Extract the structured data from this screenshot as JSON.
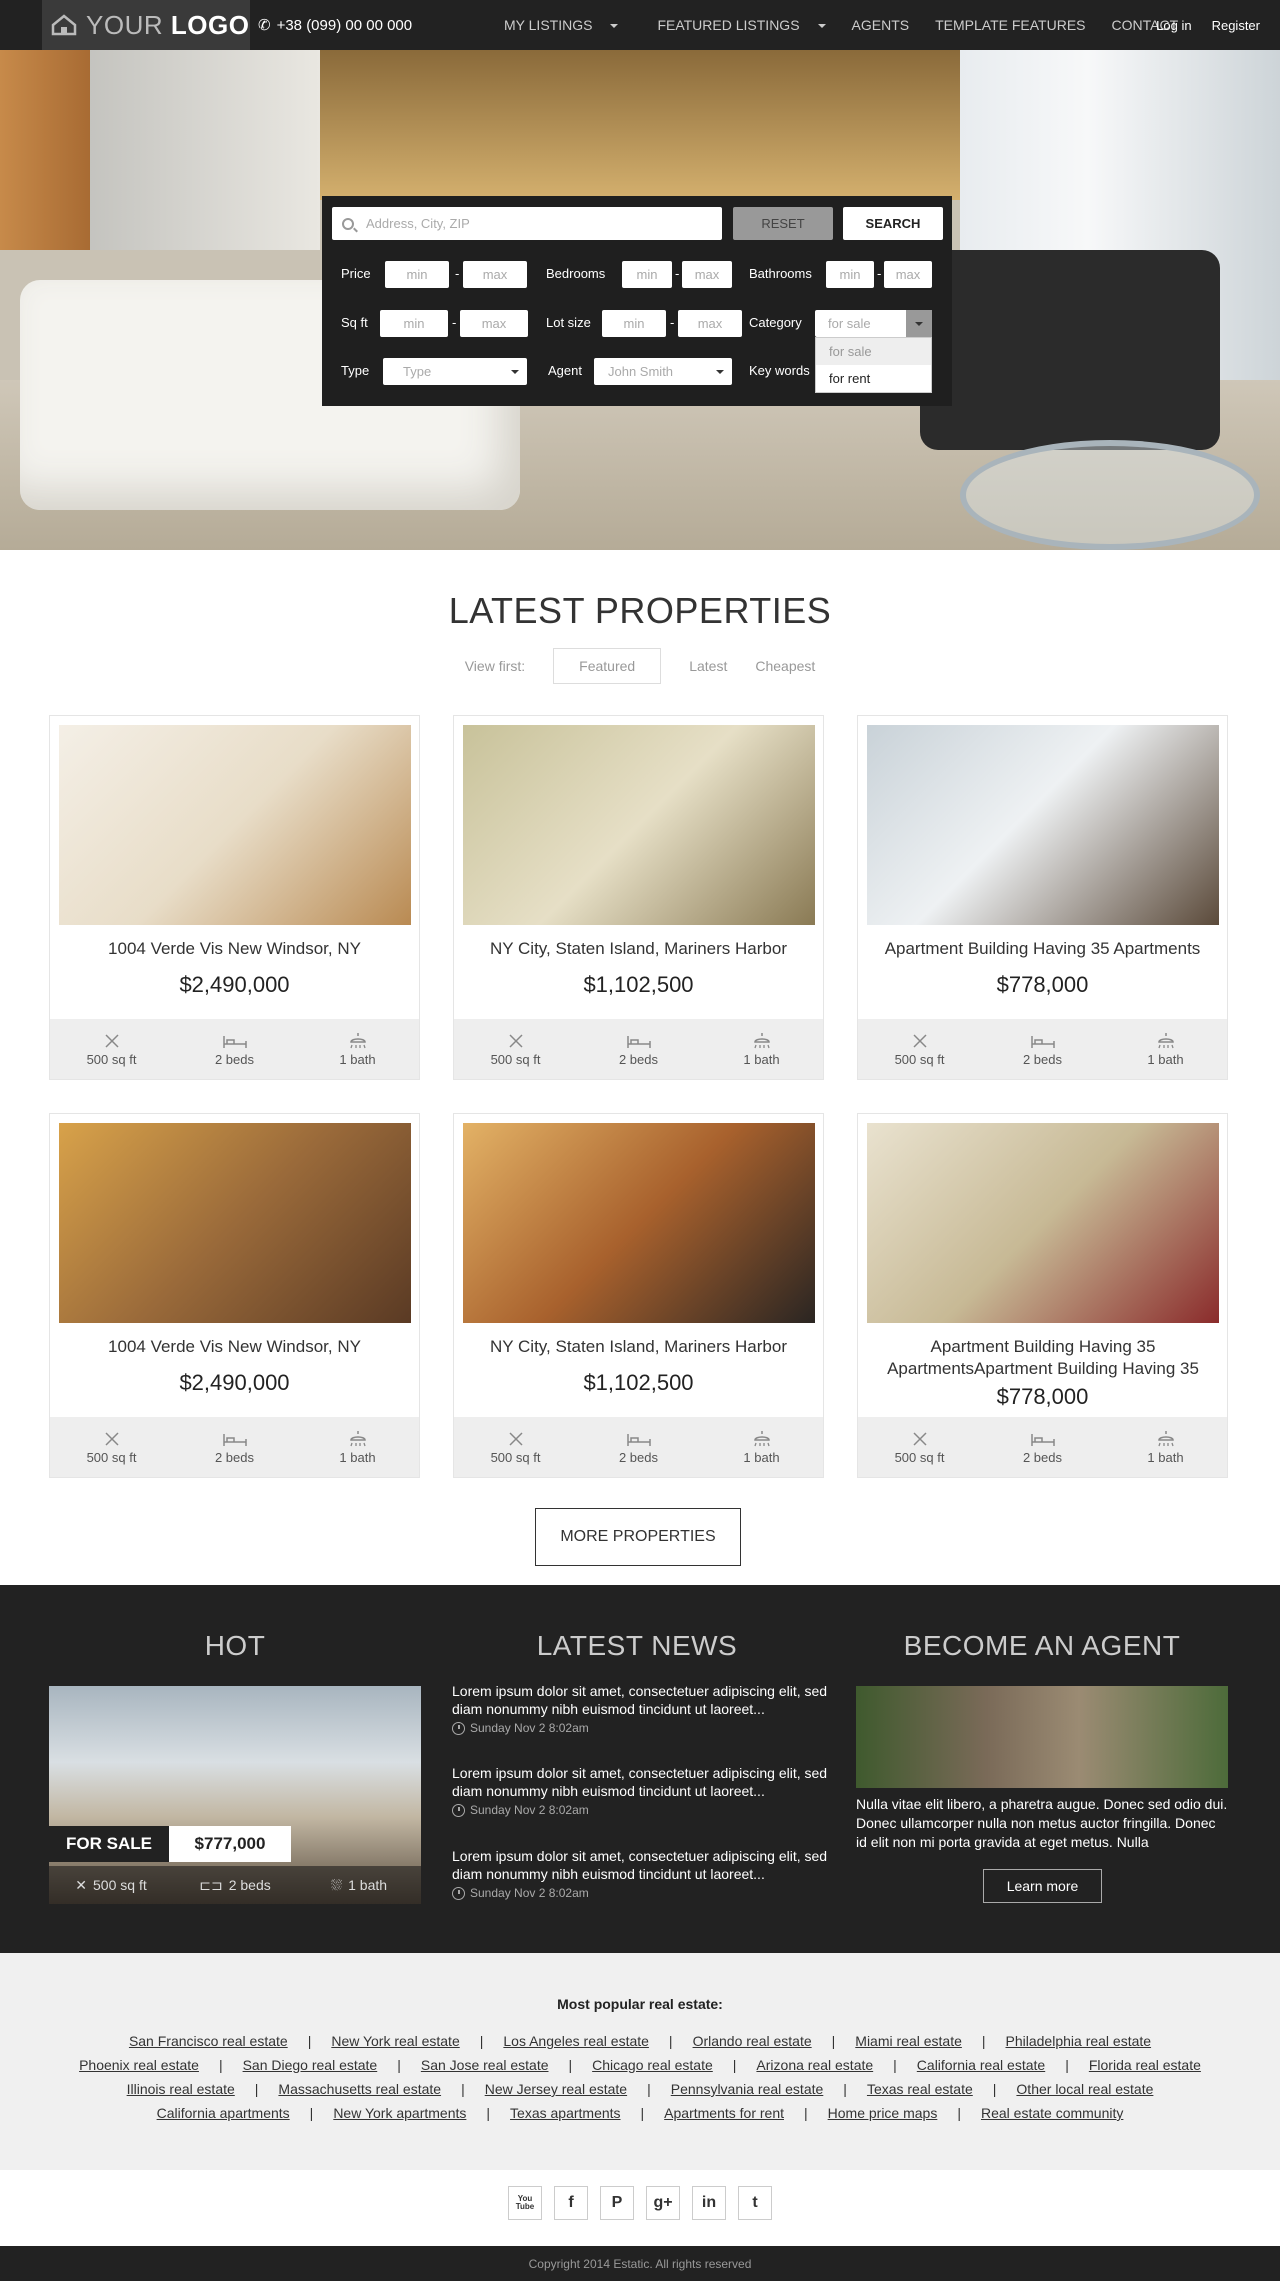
{
  "nav": {
    "logo_light": "YOUR",
    "logo_bold": "LOGO",
    "phone": "+38 (099) 00 00 000",
    "links": [
      "MY LISTINGS",
      "FEATURED LISTINGS",
      "AGENTS",
      "TEMPLATE FEATURES",
      "CONTACT"
    ],
    "login": "Log in",
    "register": "Register"
  },
  "search": {
    "address_placeholder": "Address, City, ZIP",
    "reset": "RESET",
    "search": "SEARCH",
    "labels": {
      "price": "Price",
      "bedrooms": "Bedrooms",
      "bathrooms": "Bathrooms",
      "sqft": "Sq ft",
      "lot": "Lot size",
      "category": "Category",
      "type": "Type",
      "agent": "Agent",
      "keywords": "Key words"
    },
    "min": "min",
    "max": "max",
    "dash": "-",
    "type_value": "Type",
    "agent_value": "John Smith",
    "category_value": "for sale",
    "category_options": [
      "for sale",
      "for rent"
    ]
  },
  "latest": {
    "title": "LATEST PROPERTIES",
    "view_first": "View first:",
    "tabs": [
      "Featured",
      "Latest",
      "Cheapest"
    ],
    "more": "MORE PROPERTIES"
  },
  "properties": [
    {
      "title": "1004 Verde Vis New Windsor, NY",
      "price": "$2,490,000",
      "sqft": "500 sq ft",
      "beds": "2 beds",
      "bath": "1 bath"
    },
    {
      "title": "NY City, Staten Island, Mariners Harbor",
      "price": "$1,102,500",
      "sqft": "500 sq ft",
      "beds": "2 beds",
      "bath": "1 bath"
    },
    {
      "title": "Apartment Building Having 35 Apartments",
      "price": "$778,000",
      "sqft": "500 sq ft",
      "beds": "2 beds",
      "bath": "1 bath"
    },
    {
      "title": "1004 Verde Vis New Windsor, NY",
      "price": "$2,490,000",
      "sqft": "500 sq ft",
      "beds": "2 beds",
      "bath": "1 bath"
    },
    {
      "title": "NY City, Staten Island, Mariners Harbor",
      "price": "$1,102,500",
      "sqft": "500 sq ft",
      "beds": "2 beds",
      "bath": "1 bath"
    },
    {
      "title": "Apartment Building Having 35 ApartmentsApartment Building Having 35",
      "price": "$778,000",
      "sqft": "500 sq ft",
      "beds": "2 beds",
      "bath": "1 bath"
    }
  ],
  "hot": {
    "title": "HOT",
    "sale": "FOR SALE",
    "price": "$777,000",
    "sqft": "500 sq ft",
    "beds": "2 beds",
    "bath": "1 bath"
  },
  "news": {
    "title": "LATEST NEWS",
    "items": [
      {
        "text": "Lorem ipsum dolor sit amet, consectetuer adipiscing elit, sed diam nonummy nibh euismod tincidunt ut laoreet...",
        "date": "Sunday Nov 2 8:02am"
      },
      {
        "text": "Lorem ipsum dolor sit amet, consectetuer adipiscing elit, sed diam nonummy nibh euismod tincidunt ut laoreet...",
        "date": "Sunday Nov 2 8:02am"
      },
      {
        "text": "Lorem ipsum dolor sit amet, consectetuer adipiscing elit, sed diam nonummy nibh euismod tincidunt ut laoreet...",
        "date": "Sunday Nov 2 8:02am"
      }
    ]
  },
  "agent": {
    "title": "BECOME AN AGENT",
    "text": "Nulla vitae elit libero, a pharetra augue. Donec sed odio dui. Donec ullamcorper nulla non metus auctor fringilla. Donec id elit non mi porta gravida at eget metus. Nulla",
    "learn": "Learn more"
  },
  "popular": {
    "title": "Most popular real estate:",
    "rows": [
      [
        "San Francisco real estate",
        "New York real estate",
        "Los Angeles real estate",
        "Orlando real estate",
        "Miami real estate",
        "Philadelphia real estate"
      ],
      [
        "Phoenix real estate",
        "San Diego real estate",
        "San Jose real estate",
        "Chicago real estate",
        "Arizona real estate",
        "California real estate",
        "Florida real estate"
      ],
      [
        "Illinois real estate",
        "Massachusetts real estate",
        "New Jersey real estate",
        "Pennsylvania real estate",
        "Texas real estate",
        "Other local real estate"
      ],
      [
        "California apartments",
        "New York apartments",
        "Texas apartments",
        "Apartments for rent",
        "Home price maps",
        "Real estate community"
      ]
    ],
    "separator": "|"
  },
  "social": [
    "youtube-icon",
    "facebook-icon",
    "pinterest-icon",
    "google-plus-icon",
    "linkedin-icon",
    "tumblr-icon"
  ],
  "social_glyphs": [
    "You Tube",
    "f",
    "P",
    "g+",
    "in",
    "t"
  ],
  "footer": "Copyright 2014 Estatic. All rights reserved"
}
